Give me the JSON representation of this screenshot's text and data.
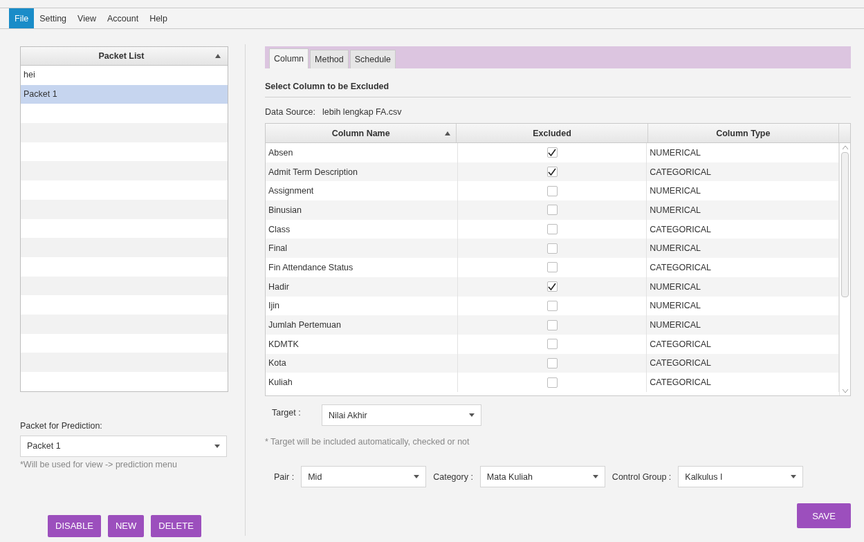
{
  "menu": [
    {
      "label": "File",
      "selected": true
    },
    {
      "label": "Setting",
      "selected": false
    },
    {
      "label": "View",
      "selected": false
    },
    {
      "label": "Account",
      "selected": false
    },
    {
      "label": "Help",
      "selected": false
    }
  ],
  "packet_list": {
    "header": "Packet List",
    "items": [
      {
        "label": "hei",
        "selected": false
      },
      {
        "label": "Packet 1",
        "selected": true
      }
    ]
  },
  "prediction": {
    "label": "Packet for Prediction:",
    "value": "Packet 1",
    "hint": "*Will be used for view -> prediction menu"
  },
  "left_buttons": [
    "DISABLE",
    "NEW",
    "DELETE"
  ],
  "tabs": [
    {
      "label": "Column",
      "selected": true
    },
    {
      "label": "Method",
      "selected": false
    },
    {
      "label": "Schedule",
      "selected": false
    }
  ],
  "section_title": "Select Column to be Excluded",
  "data_source": {
    "label": "Data Source:",
    "value": "lebih lengkap FA.csv"
  },
  "table": {
    "columns": [
      "Column Name",
      "Excluded",
      "Column Type"
    ],
    "rows": [
      {
        "name": "Absen",
        "excluded": true,
        "type": "NUMERICAL"
      },
      {
        "name": "Admit Term Description",
        "excluded": true,
        "type": "CATEGORICAL"
      },
      {
        "name": "Assignment",
        "excluded": false,
        "type": "NUMERICAL"
      },
      {
        "name": "Binusian",
        "excluded": false,
        "type": "NUMERICAL"
      },
      {
        "name": "Class",
        "excluded": false,
        "type": "CATEGORICAL"
      },
      {
        "name": "Final",
        "excluded": false,
        "type": "NUMERICAL"
      },
      {
        "name": "Fin Attendance Status",
        "excluded": false,
        "type": "CATEGORICAL"
      },
      {
        "name": "Hadir",
        "excluded": true,
        "type": "NUMERICAL"
      },
      {
        "name": "Ijin",
        "excluded": false,
        "type": "NUMERICAL"
      },
      {
        "name": "Jumlah Pertemuan",
        "excluded": false,
        "type": "NUMERICAL"
      },
      {
        "name": "KDMTK",
        "excluded": false,
        "type": "CATEGORICAL"
      },
      {
        "name": "Kota",
        "excluded": false,
        "type": "CATEGORICAL"
      },
      {
        "name": "Kuliah",
        "excluded": false,
        "type": "CATEGORICAL"
      }
    ]
  },
  "target": {
    "label": "Target :",
    "value": "Nilai Akhir",
    "note": "* Target will be included automatically, checked or not"
  },
  "filters": [
    {
      "label": "Pair :",
      "value": "Mid"
    },
    {
      "label": "Category :",
      "value": "Mata Kuliah"
    },
    {
      "label": "Control Group :",
      "value": "Kalkulus I"
    }
  ],
  "save_button": "SAVE"
}
